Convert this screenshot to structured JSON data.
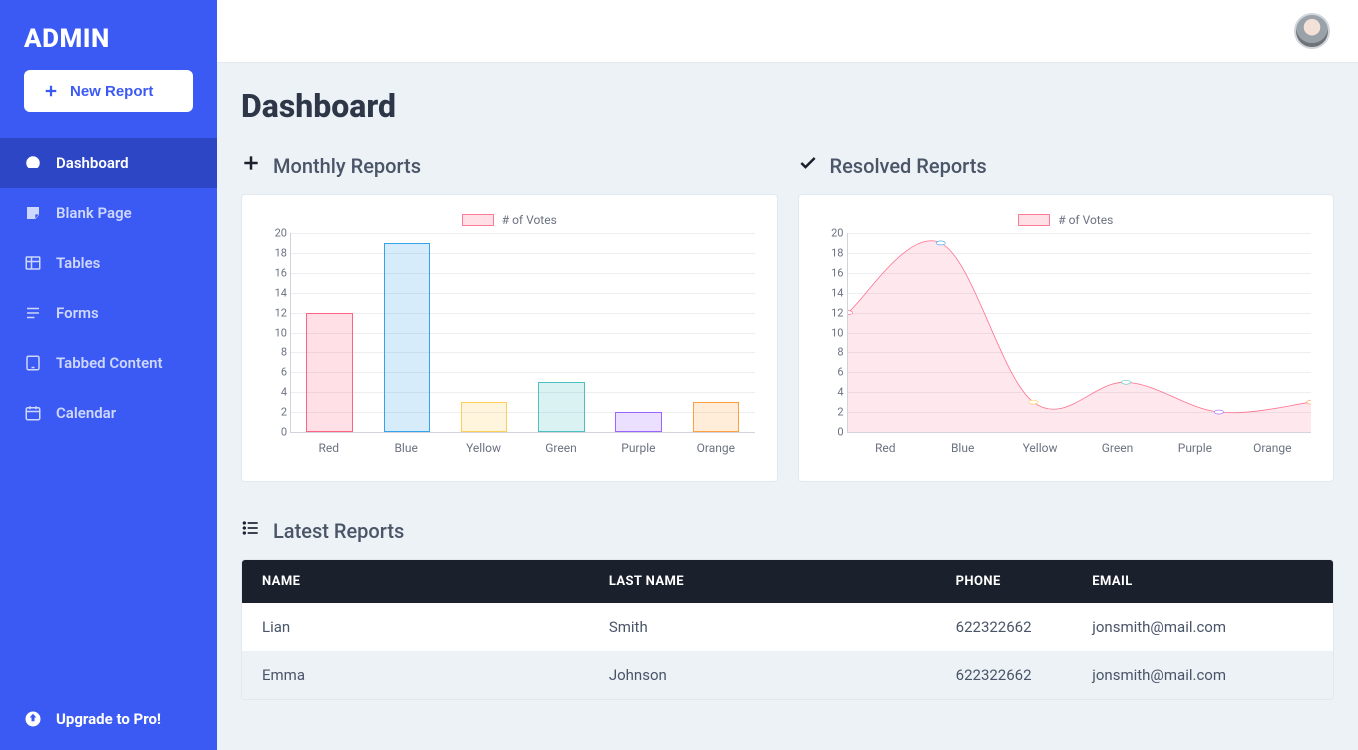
{
  "brand": "ADMIN",
  "new_report_label": "New Report",
  "page_title": "Dashboard",
  "upgrade_label": "Upgrade to Pro!",
  "sidebar_items": [
    {
      "label": "Dashboard",
      "icon": "gauge",
      "active": true
    },
    {
      "label": "Blank Page",
      "icon": "sticky",
      "active": false
    },
    {
      "label": "Tables",
      "icon": "table",
      "active": false
    },
    {
      "label": "Forms",
      "icon": "list",
      "active": false
    },
    {
      "label": "Tabbed Content",
      "icon": "tablet",
      "active": false
    },
    {
      "label": "Calendar",
      "icon": "calendar",
      "active": false
    }
  ],
  "panels": {
    "monthly": {
      "title": "Monthly Reports",
      "legend": "# of Votes"
    },
    "resolved": {
      "title": "Resolved Reports",
      "legend": "# of Votes"
    },
    "latest": {
      "title": "Latest Reports"
    }
  },
  "latest_table": {
    "headers": {
      "name": "NAME",
      "last": "LAST NAME",
      "phone": "PHONE",
      "email": "EMAIL"
    },
    "rows": [
      {
        "name": "Lian",
        "last": "Smith",
        "phone": "622322662",
        "email": "jonsmith@mail.com"
      },
      {
        "name": "Emma",
        "last": "Johnson",
        "phone": "622322662",
        "email": "jonsmith@mail.com"
      }
    ]
  },
  "chart_data": [
    {
      "type": "bar",
      "title": "Monthly Reports",
      "legend": "# of Votes",
      "categories": [
        "Red",
        "Blue",
        "Yellow",
        "Green",
        "Purple",
        "Orange"
      ],
      "values": [
        12,
        19,
        3,
        5,
        2,
        3
      ],
      "ylim": [
        0,
        20
      ],
      "y_ticks": [
        0,
        2,
        4,
        6,
        8,
        10,
        12,
        14,
        16,
        18,
        20
      ],
      "colors": {
        "fill": [
          "rgba(255,99,132,0.2)",
          "rgba(54,162,235,0.2)",
          "rgba(255,206,86,0.2)",
          "rgba(75,192,192,0.2)",
          "rgba(153,102,255,0.2)",
          "rgba(255,159,64,0.2)"
        ],
        "border": [
          "rgba(255,99,132,1)",
          "rgba(54,162,235,1)",
          "rgba(255,206,86,1)",
          "rgba(75,192,192,1)",
          "rgba(153,102,255,1)",
          "rgba(255,159,64,1)"
        ]
      }
    },
    {
      "type": "area",
      "title": "Resolved Reports",
      "legend": "# of Votes",
      "categories": [
        "Red",
        "Blue",
        "Yellow",
        "Green",
        "Purple",
        "Orange"
      ],
      "values": [
        12,
        19,
        3,
        5,
        2,
        3
      ],
      "ylim": [
        0,
        20
      ],
      "y_ticks": [
        0,
        2,
        4,
        6,
        8,
        10,
        12,
        14,
        16,
        18,
        20
      ],
      "line_color": "rgba(255,99,132,0.9)",
      "fill_color": "rgba(255,99,132,0.15)",
      "point_colors": [
        "rgba(255,99,132,1)",
        "rgba(54,162,235,1)",
        "rgba(255,206,86,1)",
        "rgba(75,192,192,1)",
        "rgba(153,102,255,1)",
        "rgba(255,159,64,1)"
      ]
    }
  ]
}
